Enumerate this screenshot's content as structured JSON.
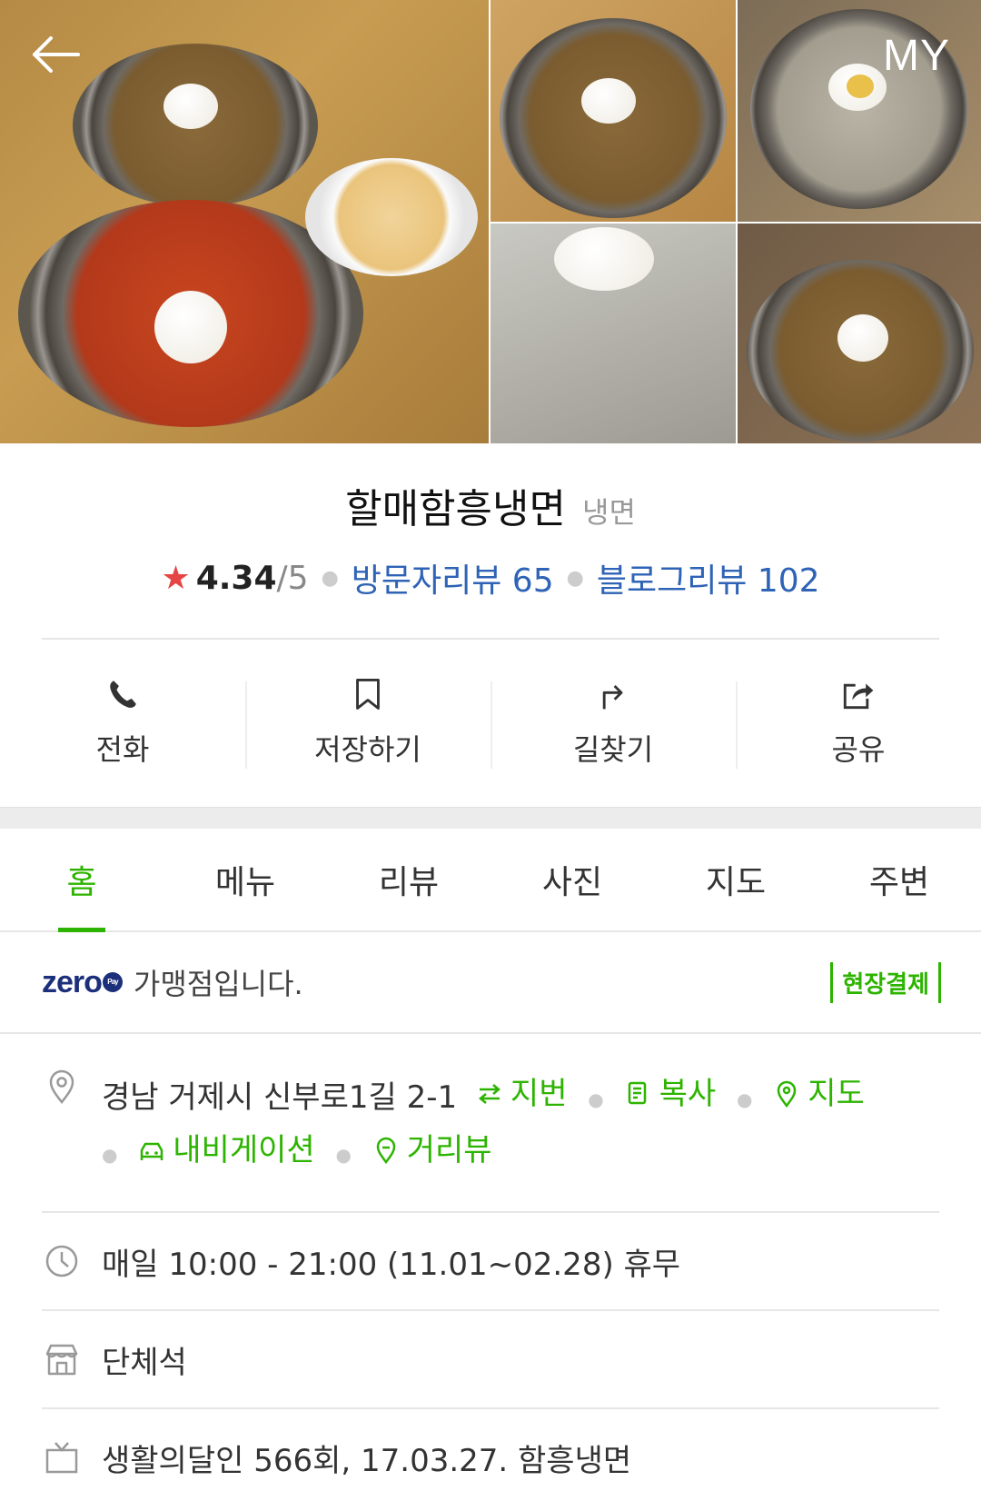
{
  "header": {
    "my_label": "MY"
  },
  "place": {
    "name": "할매함흥냉면",
    "category": "냉면",
    "rating": "4.34",
    "rating_max": "/5",
    "visitor_reviews": "방문자리뷰 65",
    "blog_reviews": "블로그리뷰 102"
  },
  "actions": [
    {
      "label": "전화",
      "icon": "phone-icon"
    },
    {
      "label": "저장하기",
      "icon": "bookmark-icon"
    },
    {
      "label": "길찾기",
      "icon": "directions-icon"
    },
    {
      "label": "공유",
      "icon": "share-icon"
    }
  ],
  "tabs": [
    {
      "label": "홈",
      "active": true
    },
    {
      "label": "메뉴",
      "active": false
    },
    {
      "label": "리뷰",
      "active": false
    },
    {
      "label": "사진",
      "active": false
    },
    {
      "label": "지도",
      "active": false
    },
    {
      "label": "주변",
      "active": false
    }
  ],
  "zeropay": {
    "logo": "zero",
    "logo_sub": "Pay",
    "text": "가맹점입니다.",
    "badge": "현장결제"
  },
  "details": {
    "address": "경남 거제시 신부로1길 2-1",
    "addr_links": {
      "jibun": "지번",
      "copy": "복사",
      "map": "지도",
      "navigation": "내비게이션",
      "streetview": "거리뷰"
    },
    "hours": "매일 10:00 - 21:00 (11.01~02.28) 휴무",
    "facility": "단체석",
    "tv": "생활의달인 566회, 17.03.27. 함흥냉면"
  },
  "colors": {
    "accent": "#2db400",
    "link": "#2e63b6",
    "star": "#e64545"
  }
}
